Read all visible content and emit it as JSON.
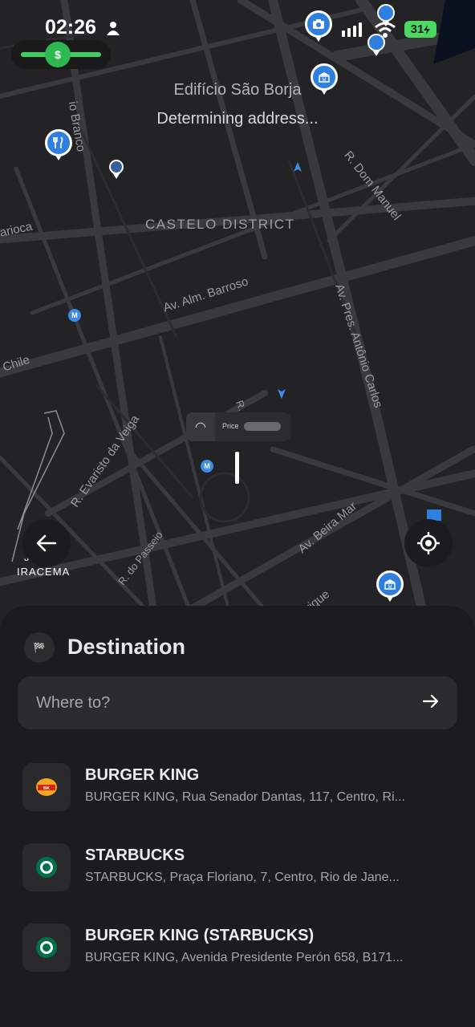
{
  "status_bar": {
    "time": "02:26",
    "battery": "31",
    "icons": [
      "person-icon",
      "signal-icon",
      "wifi-icon",
      "lock-icon",
      "battery-charging-icon"
    ]
  },
  "earnings_pill": {
    "symbol": "$",
    "icon": "dollar-coin-icon"
  },
  "map": {
    "place_name": "Edifício São Borja",
    "address_status": "Determining address...",
    "district": "CASTELO DISTRICT",
    "streets": [
      "io Branco",
      "R. Dom Manuel",
      "arioca",
      "Av. Alm. Barroso",
      "Chile",
      "Av. Pres. Antônio Carlos",
      "R. Evaristo da Veiga",
      "R. M",
      "R. do Passeio",
      "Av. Beira Mar",
      "nrique"
    ],
    "corner_labels": [
      "J",
      "IRACEMA"
    ],
    "price_chip": {
      "label": "Price"
    },
    "metro_symbol": "M",
    "pin_icons": [
      "camera-pin-icon",
      "bank-pin-icon",
      "restaurant-pin-icon",
      "bank-pin-icon"
    ]
  },
  "buttons": {
    "back": "arrow-left-icon",
    "locate": "crosshair-icon"
  },
  "destination": {
    "title": "Destination",
    "search_placeholder": "Where to?",
    "suggestions": [
      {
        "name": "BURGER KING",
        "address": "BURGER KING, Rua Senador Dantas, 117, Centro, Ri...",
        "logo": "burger-king-logo-icon"
      },
      {
        "name": "STARBUCKS",
        "address": "STARBUCKS, Praça Floriano, 7, Centro, Rio de Jane...",
        "logo": "starbucks-logo-icon"
      },
      {
        "name": "BURGER KING (STARBUCKS)",
        "address": "BURGER KING, Avenida Presidente Perón 658, B171...",
        "logo": "starbucks-logo-icon"
      }
    ]
  },
  "colors": {
    "accent_blue": "#2f7fe0",
    "battery_green": "#4bd964",
    "sheet": "#1c1c1f",
    "map_bg": "#232326"
  }
}
